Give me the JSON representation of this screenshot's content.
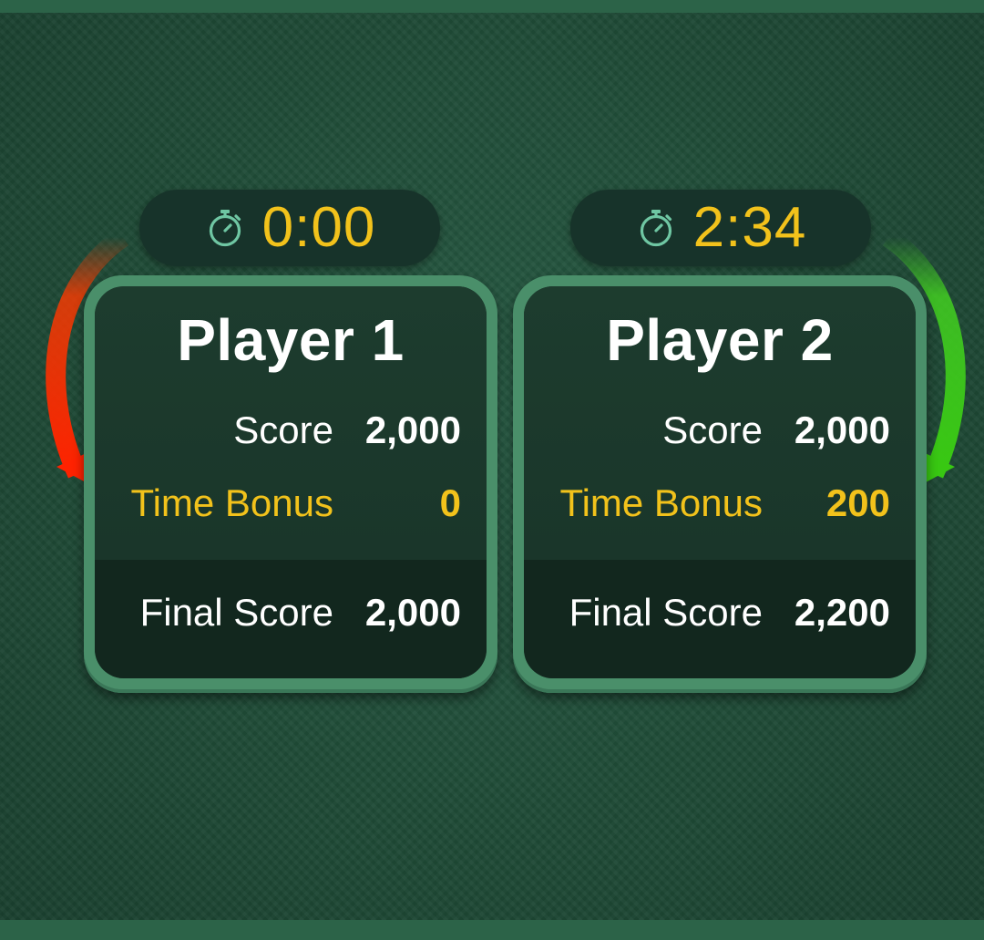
{
  "players": [
    {
      "timer": "0:00",
      "name": "Player 1",
      "score_label": "Score",
      "score": "2,000",
      "time_bonus_label": "Time Bonus",
      "time_bonus": "0",
      "final_label": "Final Score",
      "final_score": "2,000"
    },
    {
      "timer": "2:34",
      "name": "Player 2",
      "score_label": "Score",
      "score": "2,000",
      "time_bonus_label": "Time Bonus",
      "time_bonus": "200",
      "final_label": "Final Score",
      "final_score": "2,200"
    }
  ],
  "icons": {
    "timer": "stopwatch-icon"
  },
  "colors": {
    "background": "#1f4a36",
    "card_border": "#4a8f6a",
    "card_fill": "#1b382b",
    "accent_gold": "#f2c21b",
    "timer_icon": "#6fc7a3",
    "arrow_left": "#ff2a00",
    "arrow_right": "#3ccf1e"
  }
}
